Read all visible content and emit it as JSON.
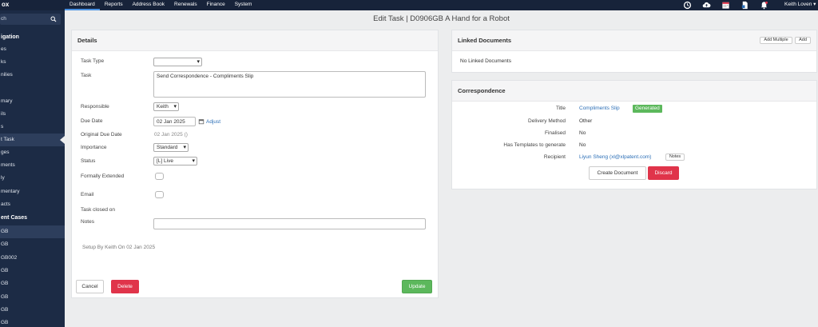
{
  "brand": "ox",
  "nav": [
    "Dashboard",
    "Reports",
    "Address Book",
    "Renewals",
    "Finance",
    "System"
  ],
  "user": "Keith Loven ▾",
  "top_icons": [
    "history-icon",
    "cloud-upload-icon",
    "calendar-icon",
    "document-icon",
    "bell-icon"
  ],
  "sidebar": {
    "search_placeholder": "ch",
    "navigation_header": "igation",
    "items_a": [
      "es",
      "ks",
      "nilies"
    ],
    "items_b": [
      "mary",
      "ils",
      "s",
      "t Task",
      "ges",
      "ments",
      "ly",
      "mentary",
      "acts"
    ],
    "recent_header": "ent Cases",
    "recent_items": [
      "GB",
      "GB",
      "GB002",
      "GB",
      "GB",
      "GB",
      "GB",
      "GB"
    ]
  },
  "page_title": "Edit Task | D0906GB A Hand for a Robot",
  "details": {
    "title": "Details",
    "task_type_label": "Task Type",
    "task_type_value": "",
    "task_label": "Task",
    "task_value": "Send Correspondence - Compliments Slip",
    "responsible_label": "Responsible",
    "responsible_value": "Keith",
    "due_date_label": "Due Date",
    "due_date_value": "02 Jan 2025",
    "adjust_label": "Adjust",
    "original_due_label": "Original Due Date",
    "original_due_value": "02 Jan 2025 ()",
    "importance_label": "Importance",
    "importance_value": "Standard",
    "status_label": "Status",
    "status_value": "[L] Live",
    "formally_extended_label": "Formally Extended",
    "email_label": "Email",
    "task_closed_label": "Task closed on",
    "notes_label": "Notes",
    "notes_value": "",
    "setup_text": "Setup By Keith On 02 Jan 2025",
    "cancel_label": "Cancel",
    "delete_label": "Delete",
    "update_label": "Update"
  },
  "linked": {
    "title": "Linked Documents",
    "add_multiple_label": "Add Multiple",
    "add_label": "Add",
    "empty_text": "No Linked Documents"
  },
  "correspondence": {
    "title": "Correspondence",
    "rows": [
      {
        "label": "Title",
        "value": "Compliments Slip"
      },
      {
        "label": "Delivery Method",
        "value": "Other"
      },
      {
        "label": "Finalised",
        "value": "No"
      },
      {
        "label": "Has Templates to generate",
        "value": "No"
      },
      {
        "label": "Recipient",
        "value": "Liyun Sheng (xl@xlpatent.com)"
      }
    ],
    "status_badge": "Generated",
    "notes_label": "Notes",
    "create_label": "Create Document",
    "discard_label": "Discard"
  },
  "colors": {
    "topbar": "#17233a",
    "sidebar": "#1c2b45",
    "accent": "#4a90e2",
    "danger": "#e0344a",
    "success": "#5cb85c"
  }
}
